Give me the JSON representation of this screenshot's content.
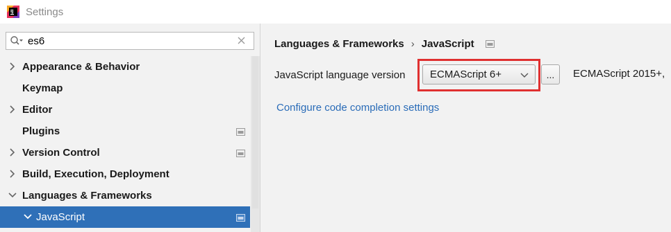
{
  "window": {
    "title": "Settings"
  },
  "search": {
    "value": "es6"
  },
  "sidebar": {
    "items": [
      {
        "label": "Appearance & Behavior"
      },
      {
        "label": "Keymap"
      },
      {
        "label": "Editor"
      },
      {
        "label": "Plugins"
      },
      {
        "label": "Version Control"
      },
      {
        "label": "Build, Execution, Deployment"
      },
      {
        "label": "Languages & Frameworks"
      },
      {
        "label": "JavaScript"
      }
    ]
  },
  "breadcrumb": {
    "parent": "Languages & Frameworks",
    "separator": "›",
    "current": "JavaScript"
  },
  "settings": {
    "language_version_label": "JavaScript language version",
    "language_version_value": "ECMAScript 6+",
    "ellipsis_label": "...",
    "language_version_description": "ECMAScript 2015+,",
    "code_completion_link": "Configure code completion settings"
  },
  "colors": {
    "selection": "#2f70b8",
    "highlight_box": "#e03030",
    "link": "#2a6cb8"
  },
  "icons": {
    "app": "intellij-idea-icon",
    "search": "search-icon",
    "clear": "close-icon",
    "project_scope": "project-scope-icon",
    "expand": "chevron-right-icon",
    "collapse": "chevron-down-icon"
  }
}
